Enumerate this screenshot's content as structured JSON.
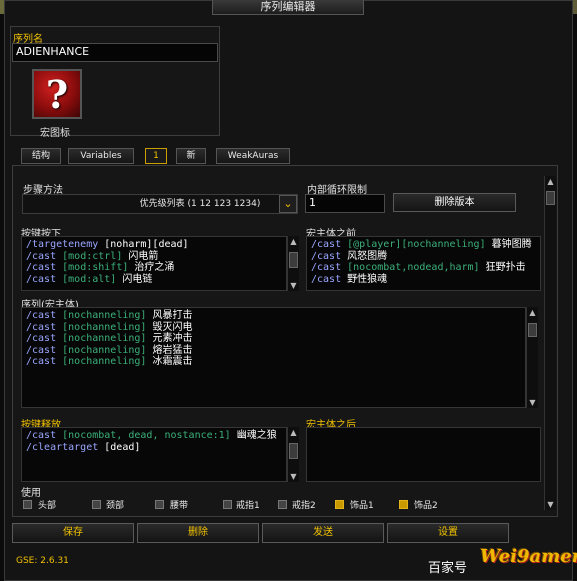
{
  "window": {
    "title": "序列编辑器"
  },
  "sequence": {
    "name_label": "序列名",
    "name_value": "ADIENHANCE",
    "icon_symbol": "?",
    "icon_caption": "宏图标"
  },
  "tabs": [
    {
      "label": "结构",
      "active": false
    },
    {
      "label": "Variables",
      "active": false
    },
    {
      "label": "1",
      "active": true
    },
    {
      "label": "新",
      "active": false
    },
    {
      "label": "WeakAuras",
      "active": false
    }
  ],
  "step": {
    "label": "步骤方法",
    "value": "优先级列表 (1 12 123 1234)",
    "arrow": "⌄"
  },
  "inner_loop": {
    "label": "内部循环限制",
    "value": "1",
    "delete_button": "删除版本"
  },
  "keypress": {
    "label": "按键按下",
    "lines": [
      [
        {
          "t": "/targetenemy",
          "c": "cmd"
        },
        {
          "t": " [noharm][dead]",
          "c": "txt"
        }
      ],
      [
        {
          "t": "/cast",
          "c": "cmd"
        },
        {
          "t": " [mod:ctrl]",
          "c": "cond"
        },
        {
          "t": " 闪电箭",
          "c": "txt"
        }
      ],
      [
        {
          "t": "/cast",
          "c": "cmd"
        },
        {
          "t": " [mod:shift]",
          "c": "cond"
        },
        {
          "t": " 治疗之涌",
          "c": "txt"
        }
      ],
      [
        {
          "t": "/cast",
          "c": "cmd"
        },
        {
          "t": " [mod:alt]",
          "c": "cond"
        },
        {
          "t": " 闪电链",
          "c": "txt"
        }
      ]
    ]
  },
  "premacro": {
    "label": "宏主体之前",
    "lines": [
      [
        {
          "t": "/cast",
          "c": "cmd"
        },
        {
          "t": " [@player][nochanneling]",
          "c": "cond"
        },
        {
          "t": " 暮钟图腾",
          "c": "txt"
        }
      ],
      [
        {
          "t": "/cast",
          "c": "cmd"
        },
        {
          "t": " 风怒图腾",
          "c": "txt"
        }
      ],
      [
        {
          "t": "/cast",
          "c": "cmd"
        },
        {
          "t": " [nocombat,nodead,harm]",
          "c": "cond"
        },
        {
          "t": " 狂野扑击",
          "c": "txt"
        }
      ],
      [
        {
          "t": "/cast",
          "c": "cmd"
        },
        {
          "t": " 野性狼魂",
          "c": "txt"
        }
      ]
    ]
  },
  "sequence_body": {
    "label": "序列(宏主体)",
    "lines": [
      [
        {
          "t": "/cast",
          "c": "cmd"
        },
        {
          "t": " [nochanneling]",
          "c": "cond"
        },
        {
          "t": " 风暴打击",
          "c": "txt"
        }
      ],
      [
        {
          "t": "/cast",
          "c": "cmd"
        },
        {
          "t": " [nochanneling]",
          "c": "cond"
        },
        {
          "t": " 毁灭闪电",
          "c": "txt"
        }
      ],
      [
        {
          "t": "/cast",
          "c": "cmd"
        },
        {
          "t": " [nochanneling]",
          "c": "cond"
        },
        {
          "t": " 元素冲击",
          "c": "txt"
        }
      ],
      [
        {
          "t": "/cast",
          "c": "cmd"
        },
        {
          "t": " [nochanneling]",
          "c": "cond"
        },
        {
          "t": " 熔岩猛击",
          "c": "txt"
        }
      ],
      [
        {
          "t": "/cast",
          "c": "cmd"
        },
        {
          "t": " [nochanneling]",
          "c": "cond"
        },
        {
          "t": " 冰霜震击",
          "c": "txt"
        }
      ]
    ]
  },
  "keyrelease": {
    "label": "按键释放",
    "lines": [
      [
        {
          "t": "/cast",
          "c": "cmd"
        },
        {
          "t": " [nocombat, dead, nostance:1]",
          "c": "cond"
        },
        {
          "t": " 幽魂之狼",
          "c": "txt"
        }
      ],
      [
        {
          "t": "/cleartarget",
          "c": "cmd"
        },
        {
          "t": " [dead]",
          "c": "txt"
        }
      ]
    ]
  },
  "postmacro": {
    "label": "宏主体之后",
    "lines": []
  },
  "use": {
    "label": "使用",
    "items": [
      {
        "label": "头部",
        "checked": false
      },
      {
        "label": "颈部",
        "checked": false
      },
      {
        "label": "腰带",
        "checked": false
      },
      {
        "label": "戒指1",
        "checked": false
      },
      {
        "label": "戒指2",
        "checked": false
      },
      {
        "label": "饰品1",
        "checked": true
      },
      {
        "label": "饰品2",
        "checked": true
      }
    ]
  },
  "footer": {
    "save": "保存",
    "delete": "删除",
    "send": "发送",
    "settings": "设置",
    "version": "GSE: 2.6.31"
  },
  "watermark": {
    "text_a": "百家号",
    "text_b": "Wei9amer"
  }
}
